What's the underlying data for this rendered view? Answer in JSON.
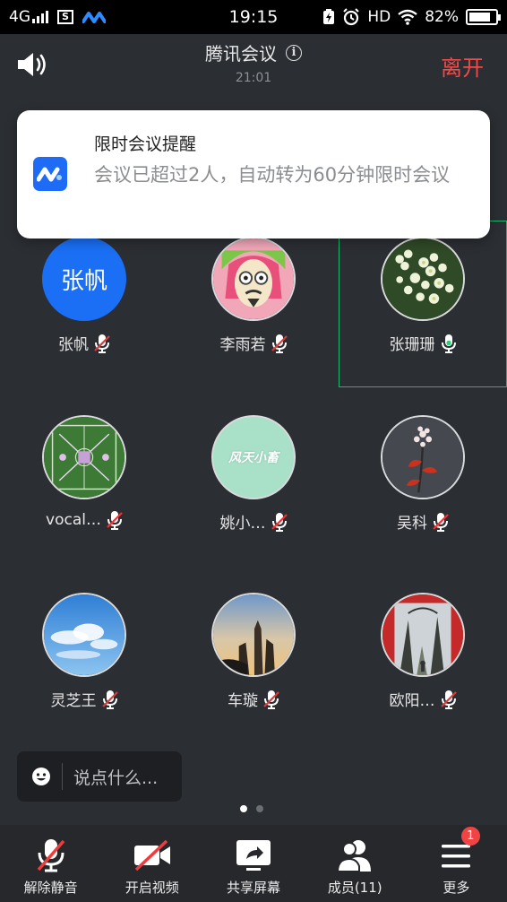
{
  "status_bar": {
    "network": "4G",
    "sim_label": "S",
    "time": "19:15",
    "hd": "HD",
    "battery": "82%"
  },
  "header": {
    "title": "腾讯会议",
    "elapsed": "21:01",
    "leave_label": "离开"
  },
  "toast": {
    "title": "限时会议提醒",
    "message": "会议已超过2人，自动转为60分钟限时会议"
  },
  "participants": [
    {
      "name": "张帆",
      "avatar_text": "张帆",
      "mic": "muted"
    },
    {
      "name": "李雨若",
      "mic": "muted"
    },
    {
      "name": "张珊珊",
      "mic": "on",
      "active_speaker": true
    },
    {
      "name": "vocal…",
      "mic": "muted"
    },
    {
      "name": "姚小…",
      "avatar_text": "风天小畜",
      "mic": "muted"
    },
    {
      "name": "吴科",
      "mic": "muted"
    },
    {
      "name": "灵芝王",
      "mic": "muted"
    },
    {
      "name": "车璇",
      "mic": "muted"
    },
    {
      "name": "欧阳…",
      "mic": "muted"
    }
  ],
  "chat": {
    "placeholder": "说点什么..."
  },
  "pager": {
    "pages": 2,
    "current": 1
  },
  "toolbar": [
    {
      "label": "解除静音",
      "icon": "mic-muted-icon"
    },
    {
      "label": "开启视频",
      "icon": "video-off-icon"
    },
    {
      "label": "共享屏幕",
      "icon": "share-screen-icon"
    },
    {
      "label": "成员(11)",
      "icon": "members-icon"
    },
    {
      "label": "更多",
      "icon": "more-menu-icon",
      "badge": "1"
    }
  ],
  "colors": {
    "accent": "#1a6ff5",
    "leave": "#f04b4b",
    "active_border": "#1fb86a",
    "background": "#2b2e33"
  }
}
